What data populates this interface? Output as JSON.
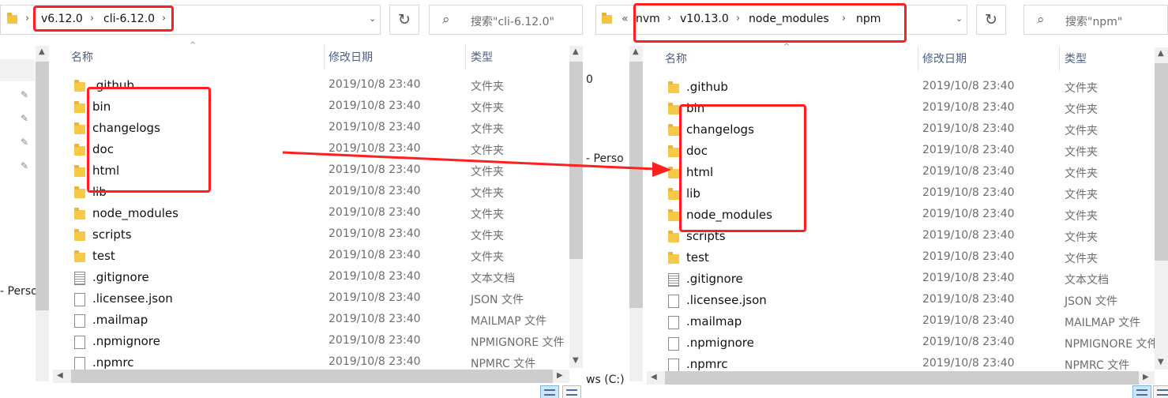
{
  "left": {
    "breadcrumb": [
      "v6.12.0",
      "cli-6.12.0"
    ],
    "search_placeholder": "搜索\"cli-6.12.0\"",
    "columns": {
      "name": "名称",
      "date": "修改日期",
      "type": "类型"
    },
    "nav_fragment": "- Perso",
    "files": [
      {
        "name": ".github",
        "date": "2019/10/8 23:40",
        "type": "文件夹",
        "icon": "folder-icon"
      },
      {
        "name": "bin",
        "date": "2019/10/8 23:40",
        "type": "文件夹",
        "icon": "folder-icon"
      },
      {
        "name": "changelogs",
        "date": "2019/10/8 23:40",
        "type": "文件夹",
        "icon": "folder-icon"
      },
      {
        "name": "doc",
        "date": "2019/10/8 23:40",
        "type": "文件夹",
        "icon": "folder-icon"
      },
      {
        "name": "html",
        "date": "2019/10/8 23:40",
        "type": "文件夹",
        "icon": "folder-icon"
      },
      {
        "name": "lib",
        "date": "2019/10/8 23:40",
        "type": "文件夹",
        "icon": "folder-icon"
      },
      {
        "name": "node_modules",
        "date": "2019/10/8 23:40",
        "type": "文件夹",
        "icon": "folder-icon"
      },
      {
        "name": "scripts",
        "date": "2019/10/8 23:40",
        "type": "文件夹",
        "icon": "folder-icon"
      },
      {
        "name": "test",
        "date": "2019/10/8 23:40",
        "type": "文件夹",
        "icon": "folder-icon"
      },
      {
        "name": ".gitignore",
        "date": "2019/10/8 23:40",
        "type": "文本文档",
        "icon": "text-file-icon"
      },
      {
        "name": ".licensee.json",
        "date": "2019/10/8 23:40",
        "type": "JSON 文件",
        "icon": "file-icon"
      },
      {
        "name": ".mailmap",
        "date": "2019/10/8 23:40",
        "type": "MAILMAP 文件",
        "icon": "file-icon"
      },
      {
        "name": ".npmignore",
        "date": "2019/10/8 23:40",
        "type": "NPMIGNORE 文件",
        "icon": "file-icon"
      },
      {
        "name": ".npmrc",
        "date": "2019/10/8 23:40",
        "type": "NPMRC 文件",
        "icon": "file-icon"
      }
    ]
  },
  "right": {
    "overflow_chevron": "«",
    "breadcrumb": [
      "nvm",
      "v10.13.0",
      "node_modules",
      "npm"
    ],
    "search_placeholder": "搜索\"npm\"",
    "columns": {
      "name": "名称",
      "date": "修改日期",
      "type": "类型"
    },
    "nav_fragments": [
      "0",
      "- Perso",
      "ws (C:)"
    ],
    "files": [
      {
        "name": ".github",
        "date": "2019/10/8 23:40",
        "type": "文件夹",
        "icon": "folder-icon"
      },
      {
        "name": "bin",
        "date": "2019/10/8 23:40",
        "type": "文件夹",
        "icon": "folder-icon"
      },
      {
        "name": "changelogs",
        "date": "2019/10/8 23:40",
        "type": "文件夹",
        "icon": "folder-icon"
      },
      {
        "name": "doc",
        "date": "2019/10/8 23:40",
        "type": "文件夹",
        "icon": "folder-icon"
      },
      {
        "name": "html",
        "date": "2019/10/8 23:40",
        "type": "文件夹",
        "icon": "folder-icon"
      },
      {
        "name": "lib",
        "date": "2019/10/8 23:40",
        "type": "文件夹",
        "icon": "folder-icon"
      },
      {
        "name": "node_modules",
        "date": "2019/10/8 23:40",
        "type": "文件夹",
        "icon": "folder-icon"
      },
      {
        "name": "scripts",
        "date": "2019/10/8 23:40",
        "type": "文件夹",
        "icon": "folder-icon"
      },
      {
        "name": "test",
        "date": "2019/10/8 23:40",
        "type": "文件夹",
        "icon": "folder-icon"
      },
      {
        "name": ".gitignore",
        "date": "2019/10/8 23:40",
        "type": "文本文档",
        "icon": "text-file-icon"
      },
      {
        "name": ".licensee.json",
        "date": "2019/10/8 23:40",
        "type": "JSON 文件",
        "icon": "file-icon"
      },
      {
        "name": ".mailmap",
        "date": "2019/10/8 23:40",
        "type": "MAILMAP 文件",
        "icon": "file-icon"
      },
      {
        "name": ".npmignore",
        "date": "2019/10/8 23:40",
        "type": "NPMIGNORE 文件",
        "icon": "file-icon"
      },
      {
        "name": ".npmrc",
        "date": "2019/10/8 23:40",
        "type": "NPMRC 文件",
        "icon": "file-icon"
      }
    ]
  },
  "annotation_color": "#ff1f1f"
}
